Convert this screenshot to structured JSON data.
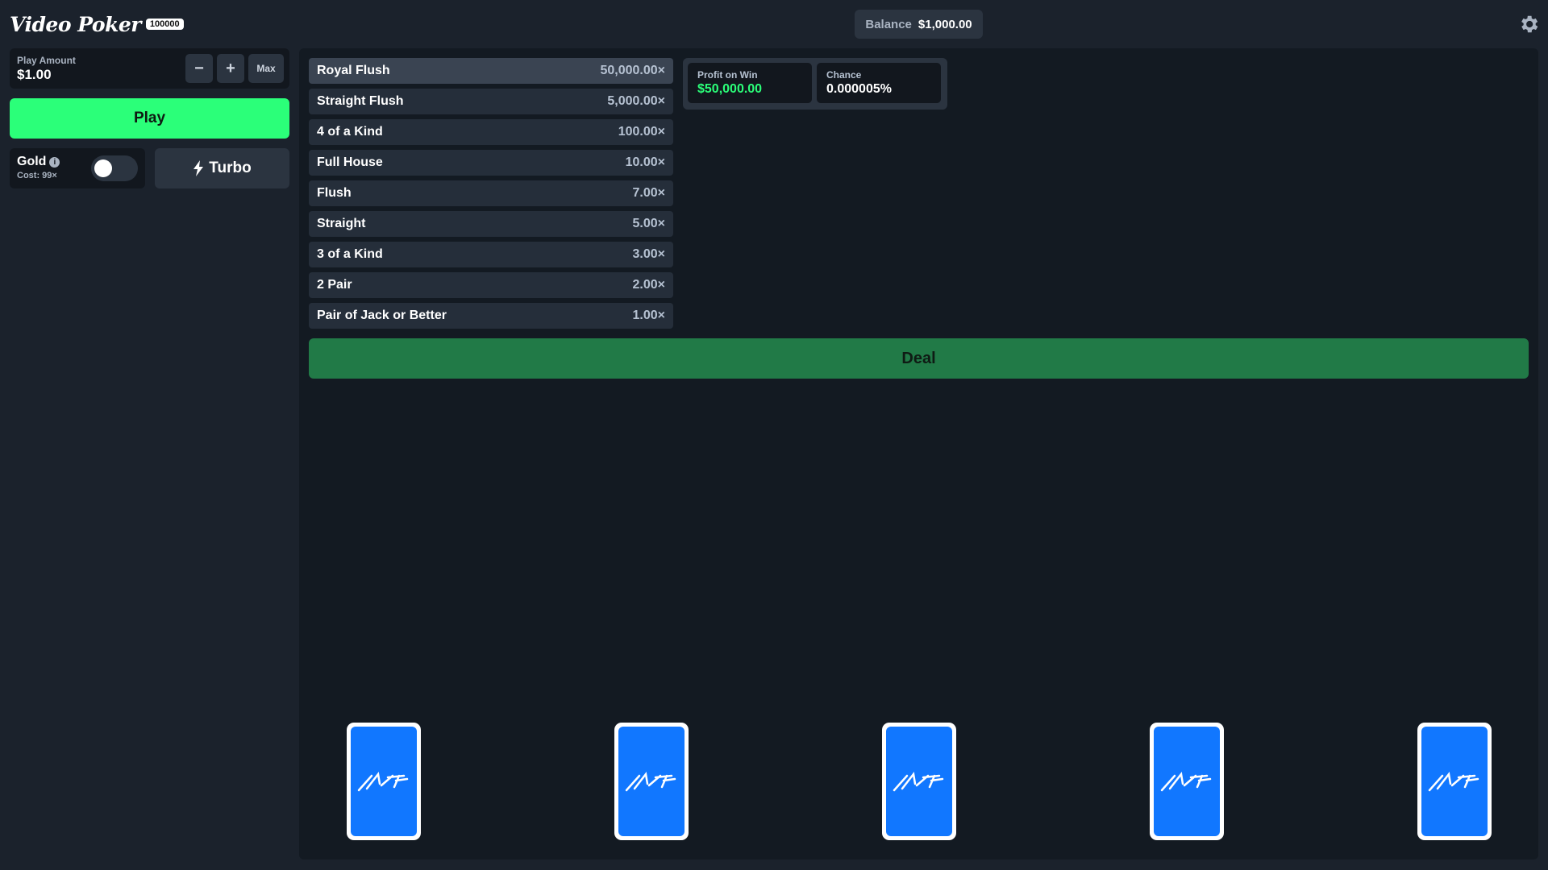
{
  "header": {
    "logo_text": "Video Poker",
    "logo_badge": "100000",
    "balance_label": "Balance",
    "balance_value": "$1,000.00",
    "settings_icon": "gear-icon"
  },
  "controls": {
    "play_amount_label": "Play Amount",
    "play_amount_value": "$1.00",
    "minus_label": "−",
    "plus_label": "+",
    "max_label": "Max",
    "play_label": "Play",
    "gold_label": "Gold",
    "gold_cost": "Cost: 99×",
    "gold_enabled": false,
    "turbo_label": "Turbo"
  },
  "paytable": [
    {
      "hand": "Royal Flush",
      "multiplier": "50,000.00×"
    },
    {
      "hand": "Straight Flush",
      "multiplier": "5,000.00×"
    },
    {
      "hand": "4 of a Kind",
      "multiplier": "100.00×"
    },
    {
      "hand": "Full House",
      "multiplier": "10.00×"
    },
    {
      "hand": "Flush",
      "multiplier": "7.00×"
    },
    {
      "hand": "Straight",
      "multiplier": "5.00×"
    },
    {
      "hand": "3 of a Kind",
      "multiplier": "3.00×"
    },
    {
      "hand": "2 Pair",
      "multiplier": "2.00×"
    },
    {
      "hand": "Pair of Jack or Better",
      "multiplier": "1.00×"
    }
  ],
  "win_info": {
    "profit_label": "Profit on Win",
    "profit_value": "$50,000.00",
    "chance_label": "Chance",
    "chance_value": "0.000005%"
  },
  "deal_label": "Deal",
  "cards_count": 5,
  "colors": {
    "play_button": "#2bff79",
    "deal_button": "#217a47",
    "card_back": "#1177ff",
    "profit_text": "#2bff79"
  }
}
